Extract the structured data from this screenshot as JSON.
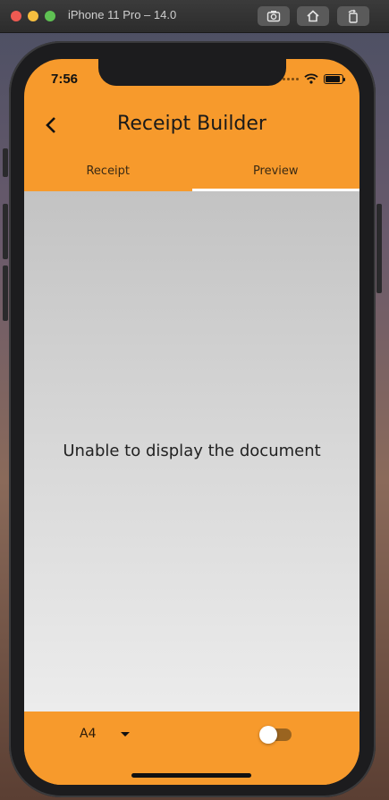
{
  "simulator": {
    "title": "iPhone 11 Pro – 14.0"
  },
  "status_bar": {
    "time": "7:56"
  },
  "app_bar": {
    "title": "Receipt Builder"
  },
  "tabs": [
    {
      "label": "Receipt",
      "active": false
    },
    {
      "label": "Preview",
      "active": true
    }
  ],
  "content": {
    "message": "Unable to display the document"
  },
  "bottom_bar": {
    "page_size": "A4",
    "toggle_on": false
  },
  "colors": {
    "accent": "#f79a2c",
    "tab_indicator": "#ffffff"
  }
}
